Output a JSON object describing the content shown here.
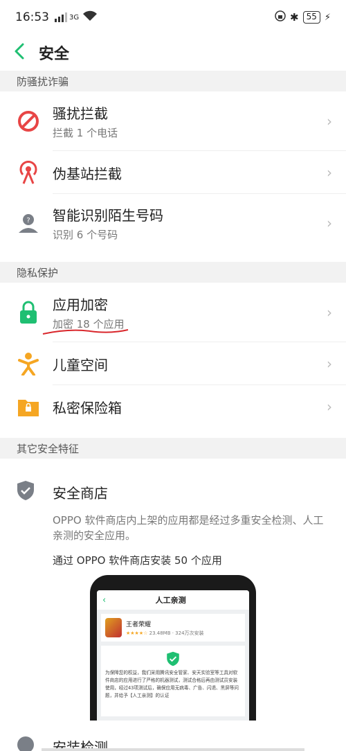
{
  "status": {
    "time": "16:53",
    "signal": "3G",
    "battery": "55"
  },
  "header": {
    "title": "安全"
  },
  "sections": {
    "s1": "防骚扰诈骗",
    "s2": "隐私保护",
    "s3": "其它安全特征"
  },
  "items": {
    "harass": {
      "title": "骚扰拦截",
      "sub": "拦截 1 个电话"
    },
    "base": {
      "title": "伪基站拦截"
    },
    "smart": {
      "title": "智能识别陌生号码",
      "sub": "识别 6 个号码"
    },
    "encrypt": {
      "title": "应用加密",
      "sub": "加密 18 个应用"
    },
    "kids": {
      "title": "儿童空间"
    },
    "vault": {
      "title": "私密保险箱"
    }
  },
  "store": {
    "title": "安全商店",
    "desc": "OPPO 软件商店内上架的应用都是经过多重安全检测、人工亲测的安全应用。",
    "count": "通过 OPPO 软件商店安装 50 个应用"
  },
  "phone": {
    "title": "人工亲测",
    "app_name": "王者荣耀",
    "stars": "★★★★☆",
    "app_meta": "23.48MB · 324万次安装",
    "note": "为保障您的权益，我们采用腾讯安全管家、安天实验室等工具对软件商店的应用进行了严格的机器测试，测试合格后再由测试员安装使用，经过43项测试后，确保应用无病毒、广告、闪退、黑屏等问题，并给予【人工亲测】的认证"
  },
  "bottom": {
    "title": "安装检测"
  },
  "colors": {
    "accent": "#1fbf72",
    "red": "#e84545",
    "orange": "#f5a623",
    "gray": "#777"
  }
}
